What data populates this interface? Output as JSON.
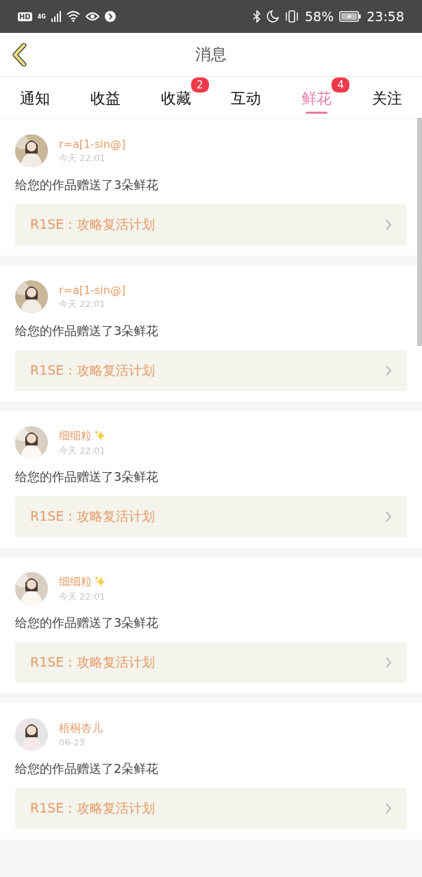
{
  "status_bar": {
    "hd": "HD",
    "network": "4G",
    "battery": "58%",
    "time": "23:58"
  },
  "header": {
    "title": "消息"
  },
  "tabs": [
    {
      "label": "通知",
      "selected": false
    },
    {
      "label": "收益",
      "selected": false
    },
    {
      "label": "收藏",
      "selected": false,
      "badge": "2"
    },
    {
      "label": "互动",
      "selected": false
    },
    {
      "label": "鲜花",
      "selected": true,
      "badge": "4"
    },
    {
      "label": "关注",
      "selected": false
    }
  ],
  "messages": [
    {
      "user": "r=a[1-sin@]",
      "sparkle": false,
      "time": "今天 22:01",
      "text": "给您的作品赠送了3朵鲜花",
      "work_prefix": "R1SE：",
      "work_title": "攻略复活计划"
    },
    {
      "user": "r=a[1-sin@]",
      "sparkle": false,
      "time": "今天 22:01",
      "text": "给您的作品赠送了3朵鲜花",
      "work_prefix": "R1SE：",
      "work_title": "攻略复活计划"
    },
    {
      "user": "细细粒",
      "sparkle": true,
      "time": "今天 22:01",
      "text": "给您的作品赠送了3朵鲜花",
      "work_prefix": "R1SE：",
      "work_title": "攻略复活计划"
    },
    {
      "user": "细细粒",
      "sparkle": true,
      "time": "今天 22:01",
      "text": "给您的作品赠送了3朵鲜花",
      "work_prefix": "R1SE：",
      "work_title": "攻略复活计划"
    },
    {
      "user": "梧桐杏儿",
      "sparkle": false,
      "time": "06-23",
      "text": "给您的作品赠送了2朵鲜花",
      "work_prefix": "R1SE：",
      "work_title": "攻略复活计划"
    }
  ]
}
